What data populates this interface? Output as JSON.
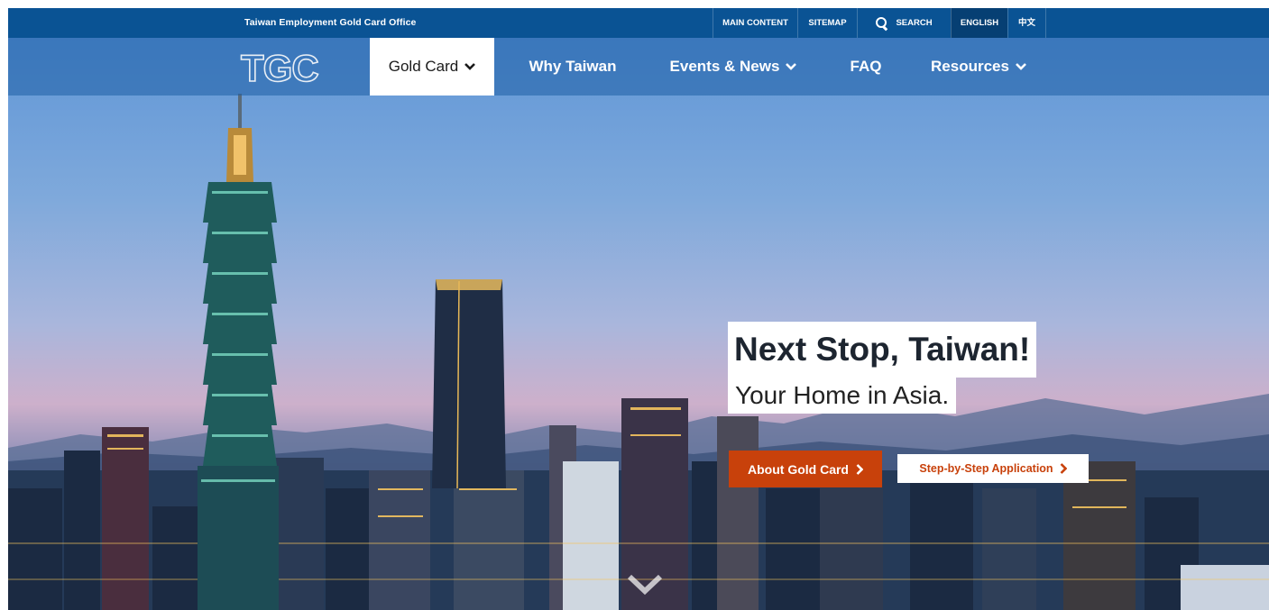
{
  "topbar": {
    "site_name": "Taiwan Employment Gold Card Office",
    "main_content": "MAIN CONTENT",
    "sitemap": "SITEMAP",
    "search": "SEARCH",
    "english": "ENGLISH",
    "chinese": "中文"
  },
  "logo": {
    "text": "TGC"
  },
  "nav": {
    "items": [
      {
        "label": "Gold Card",
        "has_dropdown": true,
        "active": true
      },
      {
        "label": "Why Taiwan",
        "has_dropdown": false,
        "active": false
      },
      {
        "label": "Events & News",
        "has_dropdown": true,
        "active": false
      },
      {
        "label": "FAQ",
        "has_dropdown": false,
        "active": false
      },
      {
        "label": "Resources",
        "has_dropdown": true,
        "active": false
      }
    ]
  },
  "hero": {
    "headline": "Next Stop, Taiwan!",
    "subheadline": "Your Home in Asia.",
    "primary_button": "About Gold Card",
    "secondary_button": "Step-by-Step Application"
  },
  "colors": {
    "topbar": "#0a5394",
    "accent": "#c8410b",
    "nav_overlay": "#1e5fa5"
  },
  "icons": {
    "search": "search-icon",
    "dropdown": "chevron-down-icon",
    "button_arrow": "chevron-right-icon",
    "scroll": "scroll-down-chevron-icon"
  }
}
